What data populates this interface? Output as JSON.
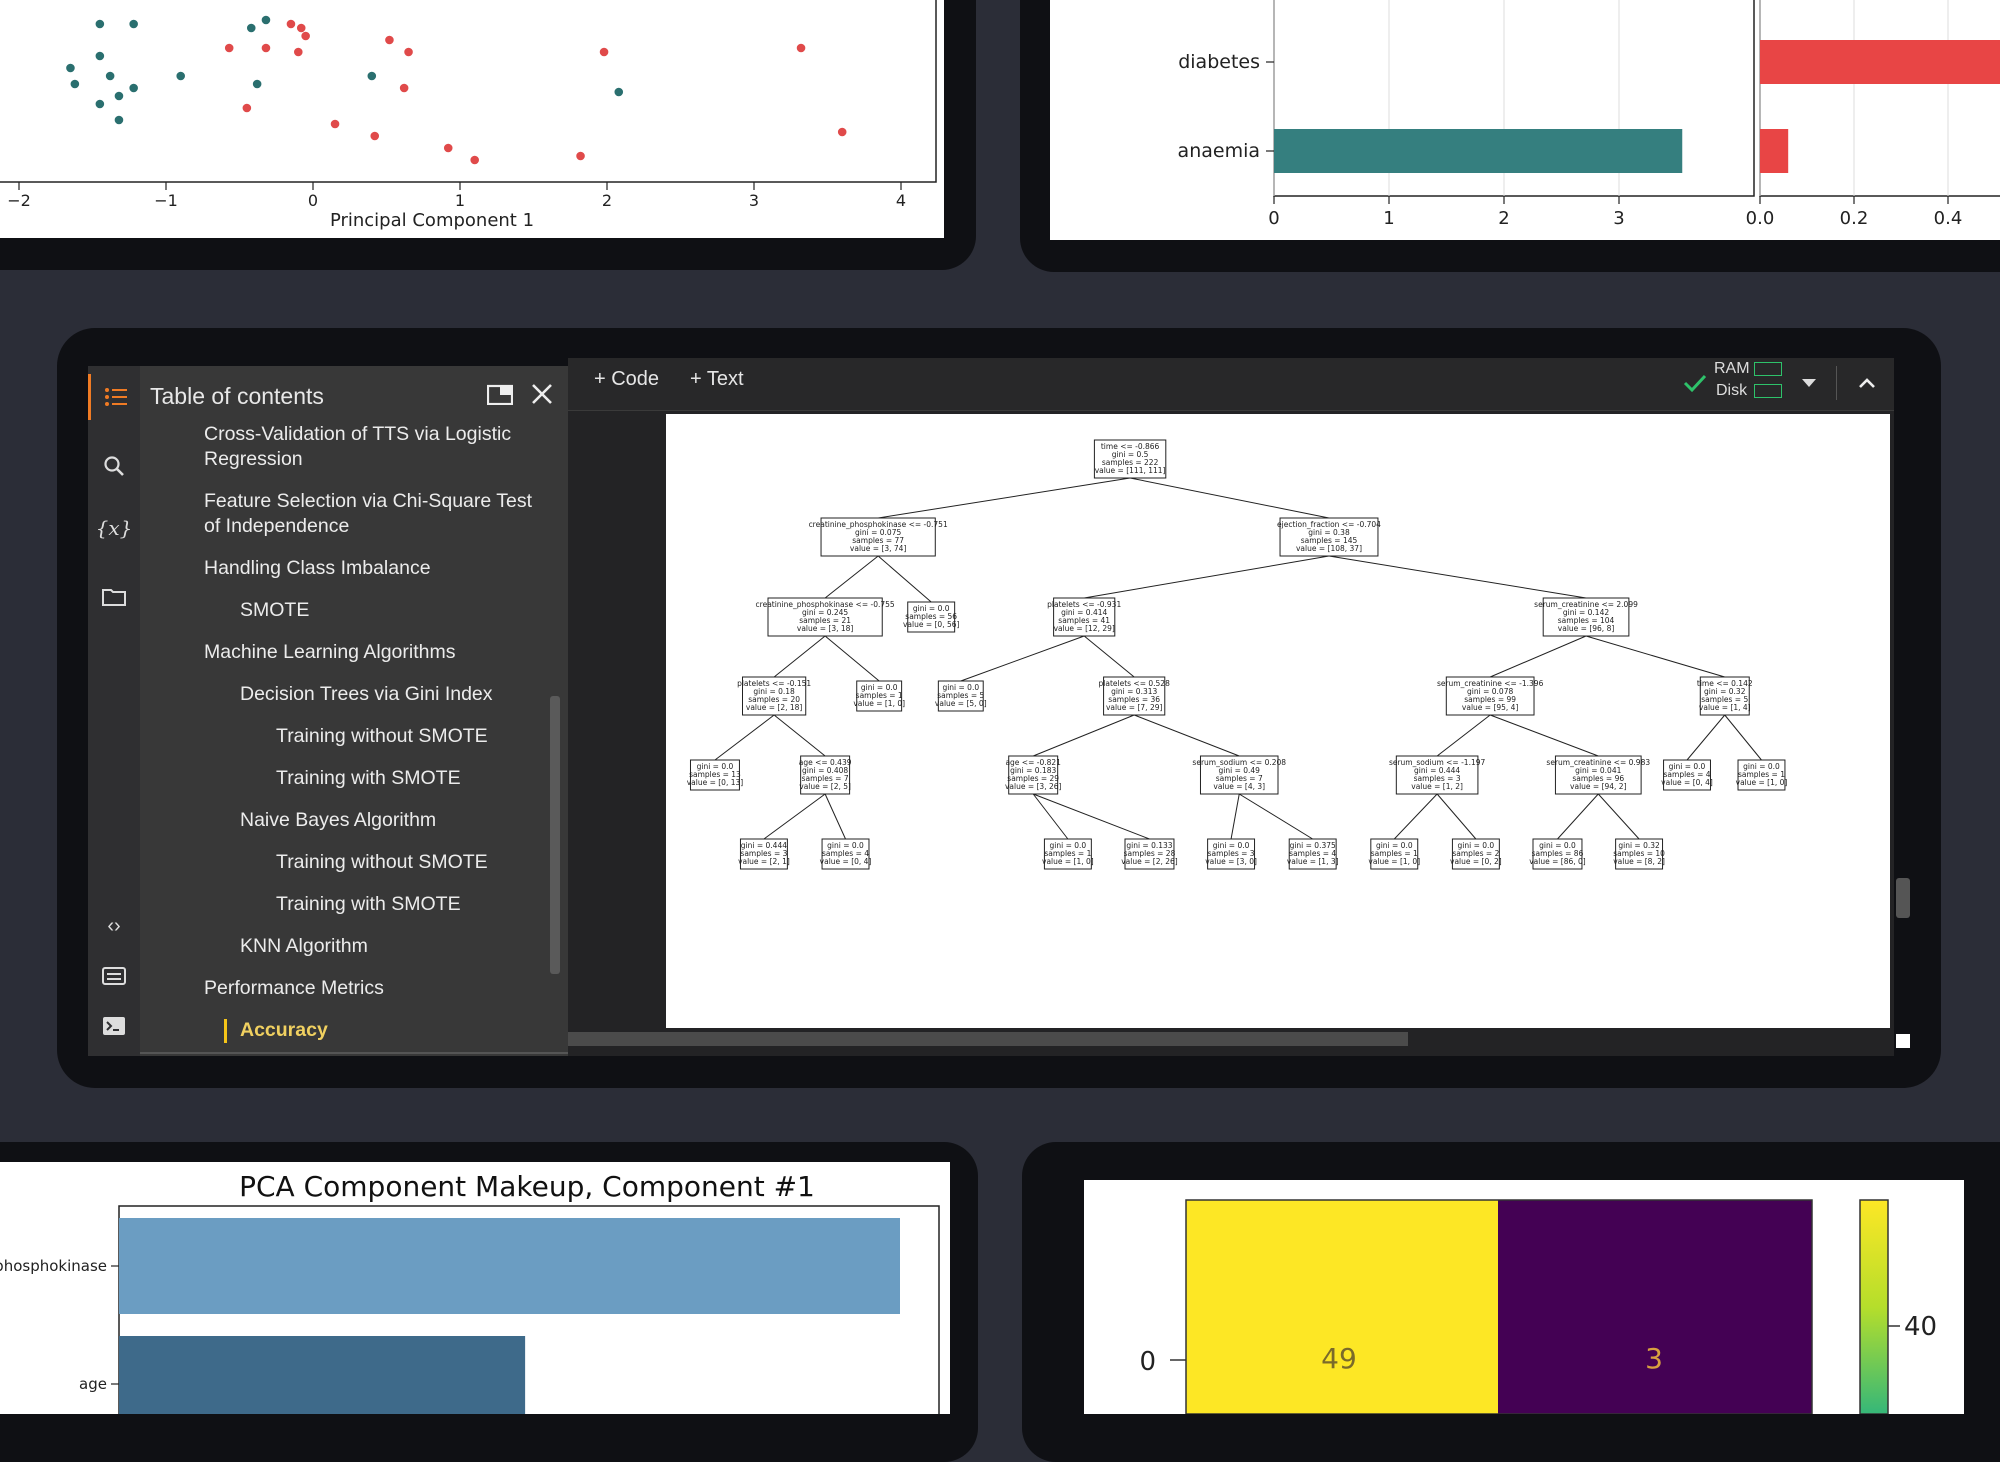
{
  "top_left_chart": {
    "xlabel": "Principal Component 1",
    "xticks": [
      "−2",
      "−1",
      "0",
      "1",
      "2",
      "3",
      "4"
    ],
    "chart_data": {
      "type": "scatter",
      "series": [
        {
          "color": "#2a6f6f",
          "points": [
            [
              -1.65,
              0.88
            ],
            [
              -1.62,
              0.84
            ],
            [
              -1.45,
              0.91
            ],
            [
              -1.38,
              0.86
            ],
            [
              -1.32,
              0.81
            ],
            [
              -1.22,
              0.83
            ],
            [
              -1.45,
              0.79
            ],
            [
              -1.32,
              0.75
            ],
            [
              -0.9,
              0.86
            ],
            [
              -0.38,
              0.84
            ],
            [
              0.4,
              0.86
            ],
            [
              2.08,
              0.82
            ],
            [
              -1.45,
              0.99
            ],
            [
              -1.22,
              0.99
            ],
            [
              -0.42,
              0.98
            ],
            [
              -0.32,
              1.0
            ]
          ]
        },
        {
          "color": "#e04a4a",
          "points": [
            [
              -0.57,
              0.93
            ],
            [
              -0.32,
              0.93
            ],
            [
              -0.1,
              0.92
            ],
            [
              0.52,
              0.95
            ],
            [
              0.65,
              0.92
            ],
            [
              0.62,
              0.83
            ],
            [
              -0.45,
              0.78
            ],
            [
              0.15,
              0.74
            ],
            [
              0.42,
              0.71
            ],
            [
              0.92,
              0.68
            ],
            [
              1.1,
              0.65
            ],
            [
              1.82,
              0.66
            ],
            [
              1.98,
              0.92
            ],
            [
              3.32,
              0.93
            ],
            [
              3.6,
              0.72
            ],
            [
              -0.15,
              0.99
            ],
            [
              -0.08,
              0.98
            ],
            [
              -0.05,
              0.96
            ]
          ]
        }
      ]
    }
  },
  "top_right_chart": {
    "left": {
      "categories": [
        "diabetes",
        "anaemia"
      ],
      "values": [
        0,
        3.55
      ],
      "xticks": [
        "0",
        "1",
        "2",
        "3"
      ],
      "color": "#357f7f"
    },
    "right": {
      "categories": [
        "diabetes",
        "anaemia"
      ],
      "values": [
        0.6,
        0.06
      ],
      "xticks": [
        "0.0",
        "0.2",
        "0.4"
      ],
      "color": "#e84545"
    }
  },
  "colab": {
    "toc_title": "Table of contents",
    "toc_items": [
      {
        "label": "Cross-Validation of TTS via Logistic\nRegression",
        "level": 1
      },
      {
        "label": "Feature Selection via Chi-Square Test\nof Independence",
        "level": 1
      },
      {
        "label": "Handling Class Imbalance",
        "level": 1
      },
      {
        "label": "SMOTE",
        "level": 2
      },
      {
        "label": "Machine Learning Algorithms",
        "level": 1
      },
      {
        "label": "Decision Trees via Gini Index",
        "level": 2
      },
      {
        "label": "Training without SMOTE",
        "level": 3
      },
      {
        "label": "Training with SMOTE",
        "level": 3
      },
      {
        "label": "Naive Bayes Algorithm",
        "level": 2
      },
      {
        "label": "Training without SMOTE",
        "level": 3
      },
      {
        "label": "Training with SMOTE",
        "level": 3
      },
      {
        "label": "KNN Algorithm",
        "level": 2
      },
      {
        "label": "Performance Metrics",
        "level": 1
      },
      {
        "label": "Accuracy",
        "level": 2,
        "active": true
      }
    ],
    "toolbar": {
      "add_code": "+ Code",
      "add_text": "+ Text",
      "ram": "RAM",
      "disk": "Disk"
    },
    "accent": "#f07b24",
    "active_marker": "#f5c518",
    "tree_nodes": [
      {
        "id": 0,
        "lines": [
          "time <= -0.866",
          "gini = 0.5",
          "samples = 222",
          "value = [111, 111]"
        ]
      },
      {
        "id": 1,
        "lines": [
          "creatinine_phosphokinase <= -0.751",
          "gini = 0.075",
          "samples = 77",
          "value = [3, 74]"
        ]
      },
      {
        "id": 2,
        "lines": [
          "ejection_fraction <= -0.704",
          "gini = 0.38",
          "samples = 145",
          "value = [108, 37]"
        ]
      },
      {
        "id": 3,
        "lines": [
          "creatinine_phosphokinase <= -0.755",
          "gini = 0.245",
          "samples = 21",
          "value = [3, 18]"
        ]
      },
      {
        "id": 4,
        "lines": [
          "gini = 0.0",
          "samples = 56",
          "value = [0, 56]"
        ]
      },
      {
        "id": 5,
        "lines": [
          "platelets <= -0.931",
          "gini = 0.414",
          "samples = 41",
          "value = [12, 29]"
        ]
      },
      {
        "id": 6,
        "lines": [
          "serum_creatinine <= 2.099",
          "gini = 0.142",
          "samples = 104",
          "value = [96, 8]"
        ]
      },
      {
        "id": 7,
        "lines": [
          "platelets <= -0.151",
          "gini = 0.18",
          "samples = 20",
          "value = [2, 18]"
        ]
      },
      {
        "id": 8,
        "lines": [
          "gini = 0.0",
          "samples = 1",
          "value = [1, 0]"
        ]
      },
      {
        "id": 9,
        "lines": [
          "gini = 0.0",
          "samples = 5",
          "value = [5, 0]"
        ]
      },
      {
        "id": 10,
        "lines": [
          "platelets <= 0.528",
          "gini = 0.313",
          "samples = 36",
          "value = [7, 29]"
        ]
      },
      {
        "id": 11,
        "lines": [
          "serum_creatinine <= -1.396",
          "gini = 0.078",
          "samples = 99",
          "value = [95, 4]"
        ]
      },
      {
        "id": 12,
        "lines": [
          "time <= 0.142",
          "gini = 0.32",
          "samples = 5",
          "value = [1, 4]"
        ]
      },
      {
        "id": 13,
        "lines": [
          "gini = 0.0",
          "samples = 13",
          "value = [0, 13]"
        ]
      },
      {
        "id": 14,
        "lines": [
          "age <= 0.439",
          "gini = 0.408",
          "samples = 7",
          "value = [2, 5]"
        ]
      },
      {
        "id": 15,
        "lines": [
          "age <= -0.821",
          "gini = 0.183",
          "samples = 29",
          "value = [3, 26]"
        ]
      },
      {
        "id": 16,
        "lines": [
          "serum_sodium <= 0.208",
          "gini = 0.49",
          "samples = 7",
          "value = [4, 3]"
        ]
      },
      {
        "id": 17,
        "lines": [
          "serum_sodium <= -1.197",
          "gini = 0.444",
          "samples = 3",
          "value = [1, 2]"
        ]
      },
      {
        "id": 18,
        "lines": [
          "serum_creatinine <= 0.983",
          "gini = 0.041",
          "samples = 96",
          "value = [94, 2]"
        ]
      },
      {
        "id": 19,
        "lines": [
          "gini = 0.0",
          "samples = 4",
          "value = [0, 4]"
        ]
      },
      {
        "id": 20,
        "lines": [
          "gini = 0.0",
          "samples = 1",
          "value = [1, 0]"
        ]
      },
      {
        "id": 21,
        "lines": [
          "gini = 0.444",
          "samples = 3",
          "value = [2, 1]"
        ]
      },
      {
        "id": 22,
        "lines": [
          "gini = 0.0",
          "samples = 4",
          "value = [0, 4]"
        ]
      },
      {
        "id": 23,
        "lines": [
          "gini = 0.0",
          "samples = 1",
          "value = [1, 0]"
        ]
      },
      {
        "id": 24,
        "lines": [
          "gini = 0.133",
          "samples = 28",
          "value = [2, 26]"
        ]
      },
      {
        "id": 25,
        "lines": [
          "gini = 0.0",
          "samples = 3",
          "value = [3, 0]"
        ]
      },
      {
        "id": 26,
        "lines": [
          "gini = 0.375",
          "samples = 4",
          "value = [1, 3]"
        ]
      },
      {
        "id": 27,
        "lines": [
          "gini = 0.0",
          "samples = 1",
          "value = [1, 0]"
        ]
      },
      {
        "id": 28,
        "lines": [
          "gini = 0.0",
          "samples = 2",
          "value = [0, 2]"
        ]
      },
      {
        "id": 29,
        "lines": [
          "gini = 0.0",
          "samples = 86",
          "value = [86, 0]"
        ]
      },
      {
        "id": 30,
        "lines": [
          "gini = 0.32",
          "samples = 10",
          "value = [8, 2]"
        ]
      }
    ],
    "tree_edges": [
      [
        0,
        1
      ],
      [
        0,
        2
      ],
      [
        1,
        3
      ],
      [
        1,
        4
      ],
      [
        2,
        5
      ],
      [
        2,
        6
      ],
      [
        3,
        7
      ],
      [
        3,
        8
      ],
      [
        5,
        9
      ],
      [
        5,
        10
      ],
      [
        6,
        11
      ],
      [
        6,
        12
      ],
      [
        7,
        13
      ],
      [
        7,
        14
      ],
      [
        10,
        15
      ],
      [
        10,
        16
      ],
      [
        11,
        17
      ],
      [
        11,
        18
      ],
      [
        12,
        19
      ],
      [
        12,
        20
      ],
      [
        14,
        21
      ],
      [
        14,
        22
      ],
      [
        15,
        23
      ],
      [
        15,
        24
      ],
      [
        16,
        25
      ],
      [
        16,
        26
      ],
      [
        17,
        27
      ],
      [
        17,
        28
      ],
      [
        18,
        29
      ],
      [
        18,
        30
      ]
    ]
  },
  "bottom_left_chart": {
    "title": "PCA Component Makeup, Component #1",
    "chart_data": {
      "type": "bar",
      "categories": [
        "phosphokinase",
        "age"
      ],
      "values": [
        1.0,
        0.52
      ],
      "colors": [
        "#6b9dc2",
        "#3e6a8a"
      ]
    }
  },
  "bottom_right_chart": {
    "chart_data": {
      "type": "heatmap",
      "row_label": "0",
      "cells": [
        {
          "value": "49",
          "color": "#fde725"
        },
        {
          "value": "3",
          "color": "#440154"
        }
      ],
      "colorbar_tick": "40"
    }
  }
}
